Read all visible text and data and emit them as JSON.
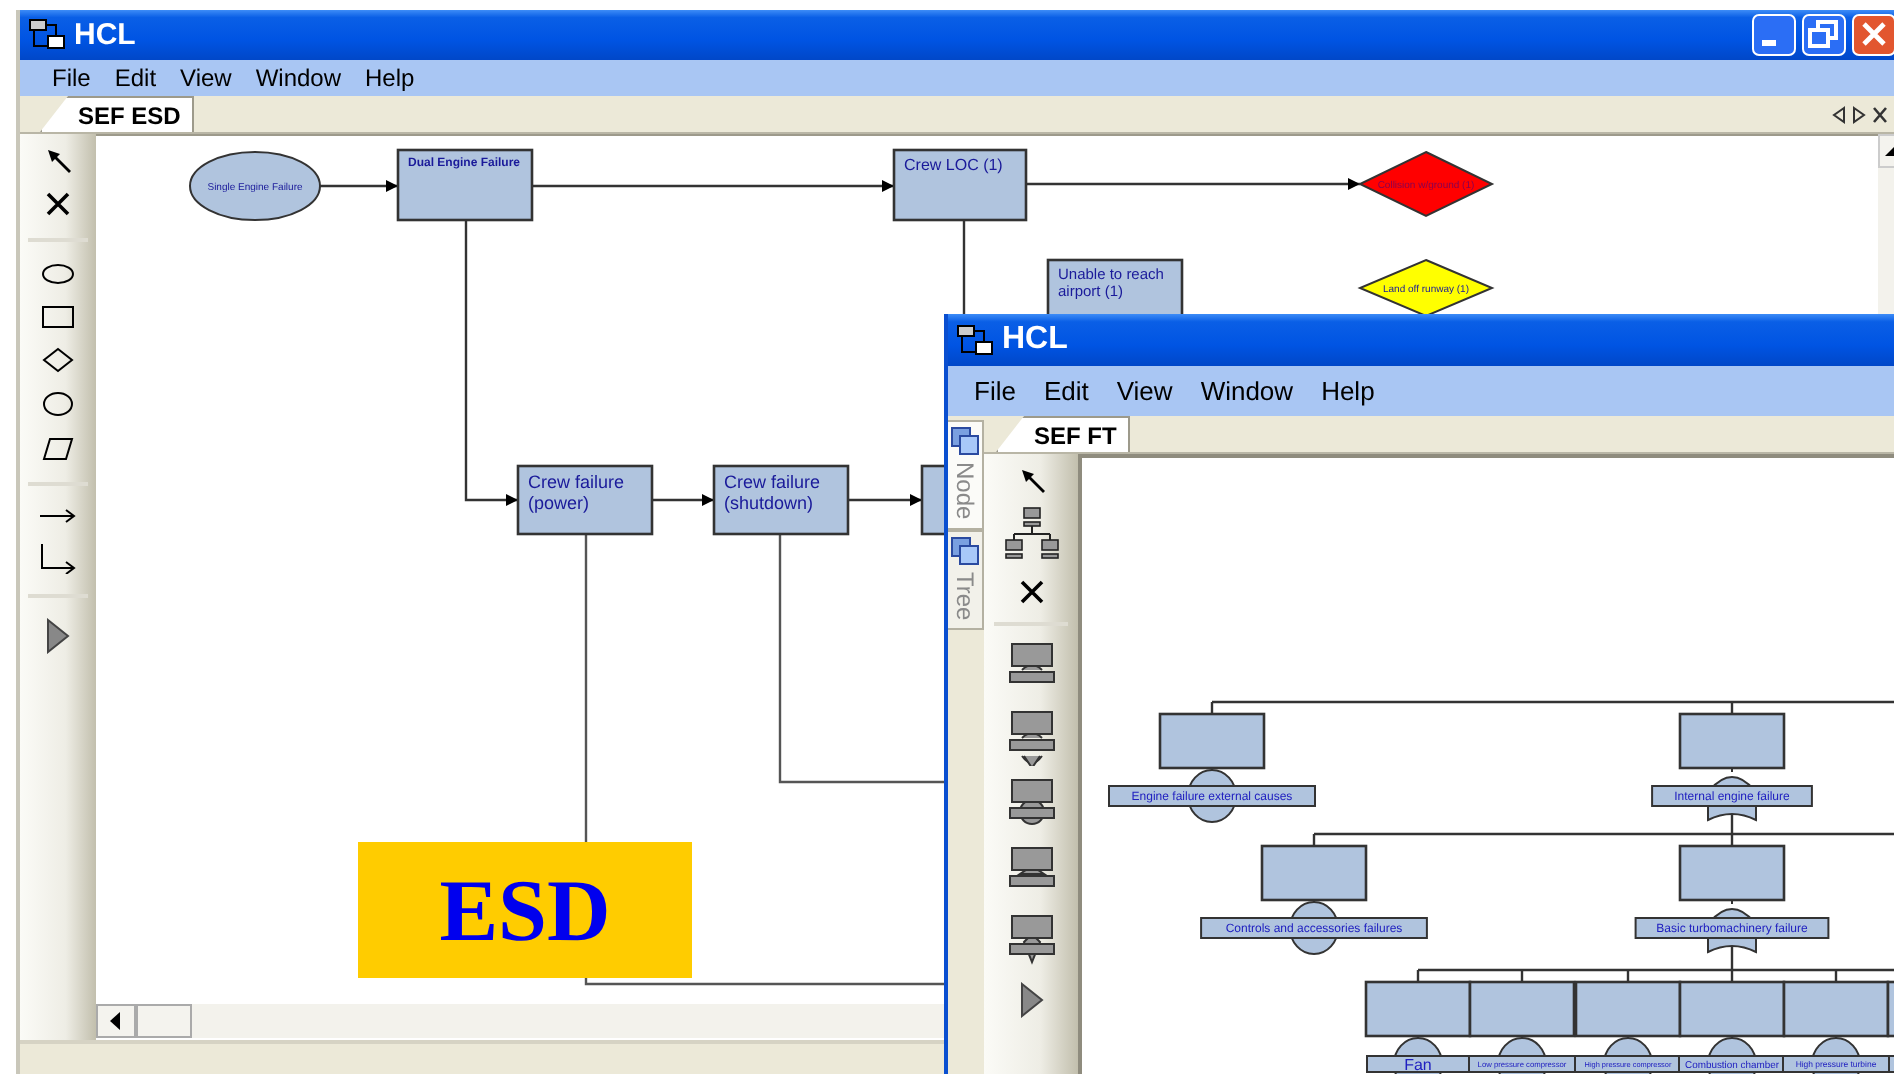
{
  "esd_window": {
    "title": "HCL",
    "menu": [
      "File",
      "Edit",
      "View",
      "Window",
      "Help"
    ],
    "tabs": [
      {
        "label": "SEF ESD",
        "selected": true
      }
    ],
    "nodes": [
      {
        "kind": "ellipse",
        "label": "Single Engine Failure"
      },
      {
        "kind": "rect",
        "label": "Dual Engine Failure"
      },
      {
        "kind": "rect",
        "label": "Crew LOC (1)"
      },
      {
        "kind": "diamond",
        "label": "Collision w/ground (1)",
        "color": "#ff0000"
      },
      {
        "kind": "rect",
        "label": "Unable to reach airport (1)"
      },
      {
        "kind": "diamond",
        "label": "Land off runway (1)",
        "color": "#ffff00"
      },
      {
        "kind": "rect",
        "label": "Crew failure (power)"
      },
      {
        "kind": "rect",
        "label": "Crew failure (shutdown)"
      },
      {
        "kind": "rect"
      }
    ],
    "annotation": "ESD"
  },
  "ft_window": {
    "title": "HCL",
    "menu": [
      "File",
      "Edit",
      "View",
      "Window",
      "Help"
    ],
    "side_tabs": [
      {
        "label": "Node",
        "selected": true
      },
      {
        "label": "Tree",
        "selected": false
      }
    ],
    "tabs": [
      {
        "label": "SEF FT",
        "selected": true
      }
    ],
    "fault_tree": [
      {
        "kind": "event",
        "label": "Engine failure external causes"
      },
      {
        "kind": "or",
        "label": "Internal engine failure",
        "children": [
          {
            "kind": "event",
            "label": "Controls and accessories failures"
          },
          {
            "kind": "or",
            "label": "Basic turbomachinery failure",
            "children": [
              {
                "kind": "event",
                "label": "Fan"
              },
              {
                "kind": "event",
                "label": "Low pressure compressor"
              },
              {
                "kind": "event",
                "label": "High pressure compressor"
              },
              {
                "kind": "event",
                "label": "Combustion chamber"
              },
              {
                "kind": "event",
                "label": "High pressure turbine"
              },
              {
                "kind": "event"
              }
            ]
          }
        ]
      }
    ]
  }
}
